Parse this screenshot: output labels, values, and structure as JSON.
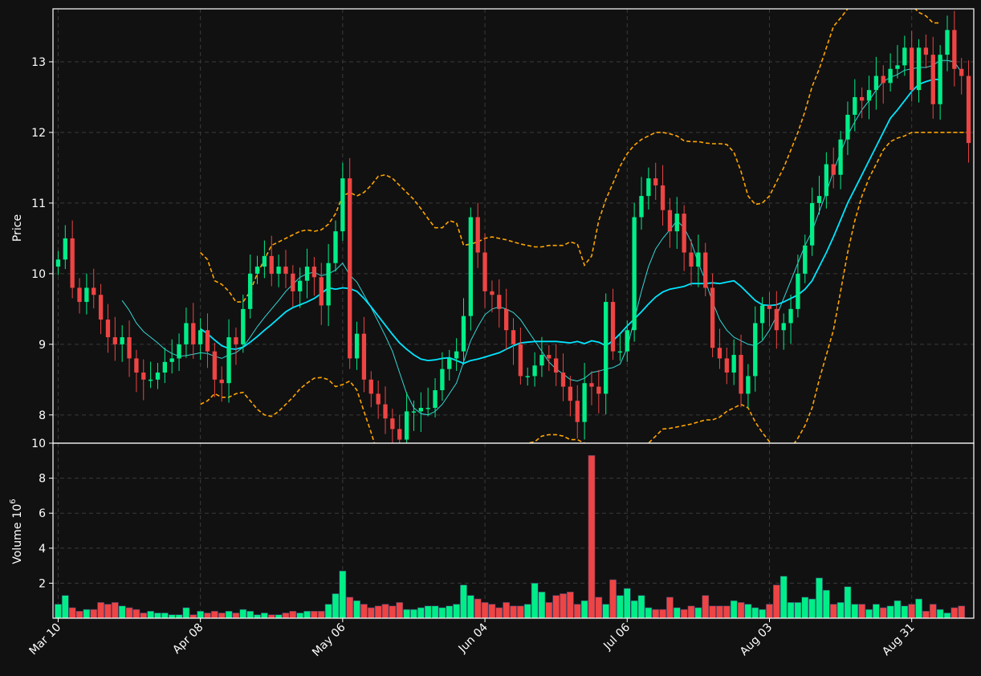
{
  "chart_data": {
    "type": "candlestick",
    "price_panel": {
      "ylabel": "Price",
      "ylim": [
        7.6,
        13.75
      ],
      "yticks": [
        8,
        9,
        10,
        11,
        12,
        13
      ],
      "overlays": [
        "moving average (fast)",
        "moving average (slow)",
        "upper band",
        "lower band"
      ]
    },
    "volume_panel": {
      "ylabel": "Volume",
      "ylabel_exponent": "10",
      "ylabel_power": "6",
      "ylim": [
        0,
        10
      ],
      "yticks": [
        2,
        4,
        6,
        8,
        10
      ]
    },
    "xticks": [
      {
        "i": 0,
        "label": "Mar 10"
      },
      {
        "i": 20,
        "label": "Apr 08"
      },
      {
        "i": 40,
        "label": "May 06"
      },
      {
        "i": 60,
        "label": "Jun 04"
      },
      {
        "i": 80,
        "label": "Jul 06"
      },
      {
        "i": 100,
        "label": "Aug 03"
      },
      {
        "i": 120,
        "label": "Aug 31"
      }
    ],
    "up_color": "#00ee88",
    "down_color": "#ee4444",
    "ma_fast_color": "#36d6d6",
    "ma_slow_color": "#00e5ff",
    "band_color": "#ffa500",
    "close": [
      10.2,
      10.5,
      9.8,
      9.6,
      9.8,
      9.7,
      9.35,
      9.1,
      9.0,
      9.1,
      8.8,
      8.6,
      8.5,
      8.5,
      8.6,
      8.75,
      8.8,
      9.0,
      9.3,
      9.0,
      9.2,
      8.9,
      8.5,
      8.45,
      9.1,
      9.0,
      9.5,
      10.0,
      10.1,
      10.25,
      10.0,
      10.1,
      10.0,
      9.75,
      9.9,
      10.1,
      9.95,
      9.55,
      10.15,
      10.6,
      11.35,
      8.8,
      9.15,
      8.5,
      8.3,
      8.15,
      7.95,
      7.8,
      7.65,
      8.05,
      8.05,
      8.1,
      8.1,
      8.35,
      8.65,
      8.8,
      8.9,
      9.4,
      10.8,
      10.3,
      9.75,
      9.7,
      9.5,
      9.2,
      9.0,
      8.55,
      8.55,
      8.7,
      8.85,
      8.8,
      8.6,
      8.4,
      8.2,
      7.9,
      8.45,
      8.4,
      8.3,
      9.6,
      8.9,
      8.9,
      9.2,
      10.8,
      11.1,
      11.35,
      11.25,
      10.9,
      10.6,
      10.85,
      10.3,
      10.1,
      10.3,
      9.8,
      8.95,
      8.8,
      8.6,
      8.85,
      8.3,
      8.55,
      9.3,
      9.55,
      9.5,
      9.2,
      9.3,
      9.5,
      10.0,
      10.4,
      11.0,
      11.1,
      11.55,
      11.4,
      11.9,
      12.25,
      12.5,
      12.45,
      12.6,
      12.8,
      12.7,
      12.9,
      12.95,
      13.2,
      12.6,
      13.2,
      13.1,
      12.4,
      13.1,
      13.45,
      12.9,
      12.8,
      11.85
    ],
    "volume": [
      0.8,
      1.3,
      0.6,
      0.4,
      0.5,
      0.5,
      0.9,
      0.8,
      0.9,
      0.7,
      0.6,
      0.5,
      0.3,
      0.4,
      0.3,
      0.3,
      0.2,
      0.2,
      0.6,
      0.2,
      0.4,
      0.3,
      0.4,
      0.3,
      0.4,
      0.3,
      0.5,
      0.4,
      0.2,
      0.3,
      0.2,
      0.2,
      0.3,
      0.4,
      0.3,
      0.4,
      0.4,
      0.4,
      0.8,
      1.4,
      2.7,
      1.2,
      1.0,
      0.8,
      0.6,
      0.7,
      0.8,
      0.7,
      0.9,
      0.5,
      0.5,
      0.6,
      0.7,
      0.7,
      0.6,
      0.7,
      0.8,
      1.9,
      1.3,
      1.1,
      0.9,
      0.8,
      0.6,
      0.9,
      0.7,
      0.7,
      0.8,
      2.0,
      1.5,
      0.9,
      1.3,
      1.4,
      1.5,
      0.8,
      1.0,
      9.3,
      1.2,
      0.8,
      2.2,
      1.3,
      1.7,
      1.0,
      1.3,
      0.6,
      0.5,
      0.5,
      1.2,
      0.6,
      0.5,
      0.7,
      0.6,
      1.3,
      0.7,
      0.7,
      0.7,
      1.0,
      0.9,
      0.8,
      0.6,
      0.5,
      0.8,
      1.9,
      2.4,
      0.9,
      0.9,
      1.2,
      1.1,
      2.3,
      1.6,
      0.8,
      0.9,
      1.8,
      0.8,
      0.8,
      0.5,
      0.8,
      0.6,
      0.7,
      1.0,
      0.7,
      0.8,
      1.1,
      0.4,
      0.8,
      0.5,
      0.3,
      0.6,
      0.7
    ],
    "moving_average_fast": [
      null,
      null,
      null,
      null,
      null,
      null,
      null,
      null,
      null,
      9.62,
      9.48,
      9.3,
      9.18,
      9.1,
      9.02,
      8.93,
      8.87,
      8.83,
      8.84,
      8.86,
      8.88,
      8.87,
      8.83,
      8.8,
      8.85,
      8.88,
      8.96,
      9.1,
      9.25,
      9.38,
      9.5,
      9.62,
      9.75,
      9.85,
      9.95,
      10.0,
      10.02,
      9.97,
      10.0,
      10.05,
      10.15,
      9.98,
      9.88,
      9.7,
      9.52,
      9.32,
      9.12,
      8.9,
      8.6,
      8.3,
      8.1,
      8.02,
      8.0,
      8.05,
      8.15,
      8.3,
      8.45,
      8.75,
      9.05,
      9.25,
      9.42,
      9.5,
      9.53,
      9.5,
      9.45,
      9.35,
      9.2,
      9.05,
      8.9,
      8.75,
      8.65,
      8.58,
      8.5,
      8.48,
      8.52,
      8.6,
      8.62,
      8.65,
      8.67,
      8.72,
      8.95,
      9.35,
      9.75,
      10.1,
      10.35,
      10.5,
      10.62,
      10.75,
      10.65,
      10.45,
      10.15,
      9.9,
      9.6,
      9.35,
      9.2,
      9.1,
      9.05,
      9.0,
      8.98,
      9.05,
      9.2,
      9.4,
      9.65,
      9.9,
      10.15,
      10.4,
      10.6,
      10.88,
      11.15,
      11.45,
      11.72,
      11.96,
      12.15,
      12.32,
      12.45,
      12.6,
      12.72,
      12.78,
      12.82,
      12.88,
      12.9,
      12.92,
      12.92,
      12.95,
      13.02,
      13.02,
      13.0,
      12.85
    ],
    "moving_average_slow": [
      null,
      null,
      null,
      null,
      null,
      null,
      null,
      null,
      null,
      null,
      null,
      null,
      null,
      null,
      null,
      null,
      null,
      null,
      null,
      null,
      9.22,
      9.15,
      9.06,
      8.98,
      8.94,
      8.93,
      8.96,
      9.03,
      9.11,
      9.2,
      9.28,
      9.37,
      9.46,
      9.52,
      9.56,
      9.6,
      9.65,
      9.72,
      9.8,
      9.78,
      9.8,
      9.79,
      9.75,
      9.65,
      9.53,
      9.4,
      9.27,
      9.14,
      9.02,
      8.93,
      8.85,
      8.79,
      8.77,
      8.78,
      8.8,
      8.81,
      8.77,
      8.73,
      8.77,
      8.79,
      8.82,
      8.85,
      8.88,
      8.93,
      8.98,
      9.02,
      9.03,
      9.04,
      9.04,
      9.04,
      9.04,
      9.03,
      9.02,
      9.04,
      9.01,
      9.05,
      9.03,
      8.98,
      9.05,
      9.15,
      9.26,
      9.36,
      9.46,
      9.57,
      9.67,
      9.74,
      9.78,
      9.8,
      9.82,
      9.86,
      9.86,
      9.86,
      9.87,
      9.86,
      9.88,
      9.9,
      9.82,
      9.72,
      9.62,
      9.56,
      9.55,
      9.56,
      9.6,
      9.65,
      9.7,
      9.78,
      9.9,
      10.1,
      10.3,
      10.52,
      10.76,
      11.0,
      11.2,
      11.4,
      11.6,
      11.8,
      12.0,
      12.2,
      12.32,
      12.45,
      12.58,
      12.68,
      12.72,
      12.75,
      12.75
    ],
    "band_upper": [
      null,
      null,
      null,
      null,
      null,
      null,
      null,
      null,
      null,
      null,
      null,
      null,
      null,
      null,
      null,
      null,
      null,
      null,
      null,
      null,
      10.3,
      10.2,
      9.9,
      9.85,
      9.75,
      9.6,
      9.6,
      9.75,
      10.0,
      10.2,
      10.4,
      10.45,
      10.5,
      10.55,
      10.6,
      10.62,
      10.6,
      10.62,
      10.7,
      10.85,
      11.1,
      11.15,
      11.1,
      11.15,
      11.25,
      11.38,
      11.4,
      11.35,
      11.25,
      11.15,
      11.05,
      10.92,
      10.78,
      10.65,
      10.65,
      10.75,
      10.72,
      10.4,
      10.42,
      10.45,
      10.5,
      10.52,
      10.5,
      10.48,
      10.45,
      10.42,
      10.4,
      10.38,
      10.38,
      10.4,
      10.4,
      10.4,
      10.45,
      10.42,
      10.12,
      10.25,
      10.75,
      11.05,
      11.28,
      11.52,
      11.7,
      11.82,
      11.9,
      11.95,
      12.0,
      12.0,
      11.98,
      11.95,
      11.88,
      11.87,
      11.87,
      11.85,
      11.84,
      11.84,
      11.83,
      11.72,
      11.45,
      11.1,
      10.98,
      11.0,
      11.1,
      11.3,
      11.5,
      11.75,
      12.0,
      12.3,
      12.65,
      12.9,
      13.2,
      13.5,
      13.62,
      13.75,
      13.8,
      13.8,
      13.8,
      13.8,
      13.8,
      13.8,
      13.8,
      13.8,
      13.8,
      13.7,
      13.65,
      13.55,
      13.55
    ],
    "band_lower": [
      null,
      null,
      null,
      null,
      null,
      null,
      null,
      null,
      null,
      null,
      null,
      null,
      null,
      null,
      null,
      null,
      null,
      null,
      null,
      null,
      8.15,
      8.2,
      8.3,
      8.25,
      8.25,
      8.3,
      8.32,
      8.2,
      8.08,
      8.0,
      7.98,
      8.05,
      8.15,
      8.25,
      8.37,
      8.45,
      8.52,
      8.53,
      8.5,
      8.4,
      8.43,
      8.48,
      8.35,
      8.05,
      7.75,
      7.42,
      7.2,
      7.05,
      6.95,
      6.9,
      6.85,
      6.85,
      6.9,
      7.0,
      7.1,
      7.2,
      7.3,
      7.4,
      7.5,
      7.5,
      7.5,
      7.5,
      7.5,
      7.5,
      7.52,
      7.55,
      7.6,
      7.62,
      7.7,
      7.72,
      7.72,
      7.7,
      7.65,
      7.65,
      7.6,
      7.58,
      7.5,
      7.5,
      7.5,
      7.5,
      7.5,
      7.5,
      7.5,
      7.6,
      7.7,
      7.8,
      7.81,
      7.83,
      7.85,
      7.87,
      7.9,
      7.93,
      7.93,
      7.97,
      8.05,
      8.1,
      8.15,
      8.1,
      7.9,
      7.75,
      7.62,
      7.45,
      7.45,
      7.53,
      7.67,
      7.85,
      8.1,
      8.5,
      8.85,
      9.2,
      9.75,
      10.3,
      10.75,
      11.1,
      11.35,
      11.55,
      11.75,
      11.87,
      11.92,
      11.95,
      12.0,
      12.0,
      12.0,
      12.0,
      12.0,
      12.0,
      12.0,
      12.0,
      12.0
    ]
  }
}
